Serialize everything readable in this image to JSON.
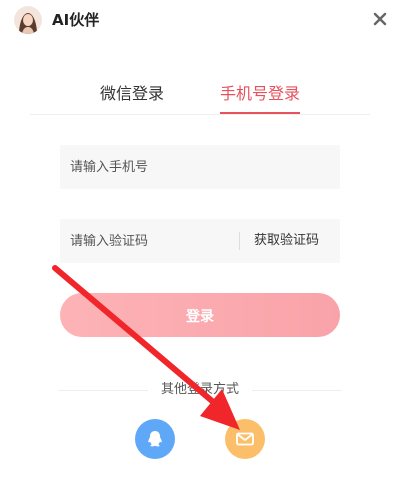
{
  "header": {
    "title": "AI伙伴",
    "avatar_icon": "avatar-icon",
    "close_icon": "close-icon"
  },
  "tabs": [
    {
      "label": "微信登录",
      "active": false
    },
    {
      "label": "手机号登录",
      "active": true
    }
  ],
  "phone_input": {
    "placeholder": "请输入手机号",
    "value": ""
  },
  "code_input": {
    "placeholder": "请输入验证码",
    "value": ""
  },
  "get_code_label": "获取验证码",
  "login_label": "登录",
  "other_login": {
    "label": "其他登录方式",
    "methods": [
      {
        "name": "qq",
        "icon": "qq-icon",
        "color": "#5fa8f8"
      },
      {
        "name": "email",
        "icon": "mail-icon",
        "color": "#fbbf6a"
      }
    ]
  },
  "colors": {
    "accent": "#e8505b",
    "login_button_start": "#fdb3b6",
    "login_button_end": "#f9a3a9",
    "annotation_arrow": "#f1262a"
  }
}
